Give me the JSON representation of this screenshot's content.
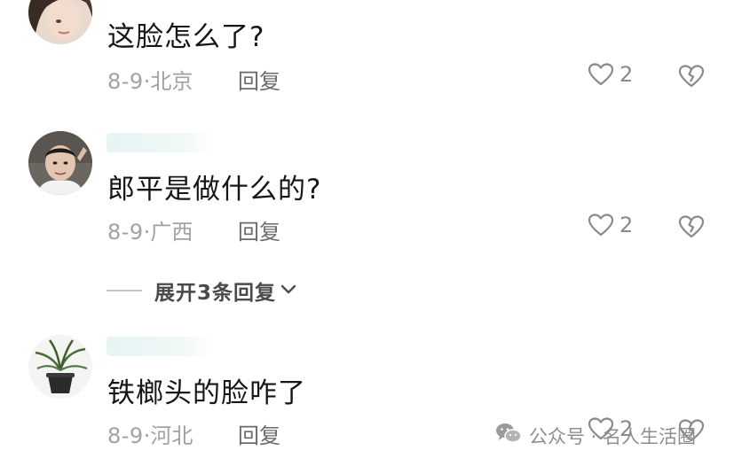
{
  "comments": [
    {
      "text": "这脸怎么了?",
      "date": "8-9",
      "location": "北京",
      "reply_label": "回复",
      "likes": "2"
    },
    {
      "text": "郎平是做什么的?",
      "date": "8-9",
      "location": "广西",
      "reply_label": "回复",
      "likes": "2"
    },
    {
      "text": "铁榔头的脸咋了",
      "date": "8-9",
      "location": "河北",
      "reply_label": "回复",
      "likes": "2"
    }
  ],
  "expand_replies": {
    "label": "展开3条回复"
  },
  "watermark": {
    "text": "公众号 · 名人生活圈"
  },
  "icons": {
    "like": "heart-outline-icon",
    "dislike": "broken-heart-icon",
    "expand": "chevron-down-icon",
    "wechat": "wechat-icon"
  },
  "colors": {
    "text": "#161616",
    "meta": "#a2a2a2",
    "reply": "#6a6a6a",
    "icon": "#8a8a8a"
  }
}
